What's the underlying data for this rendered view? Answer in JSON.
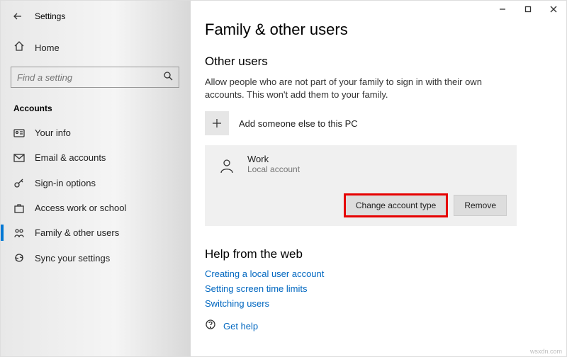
{
  "titlebar": {
    "minimize": "—",
    "maximize": "□",
    "close": "✕"
  },
  "header": {
    "app_title": "Settings"
  },
  "sidebar": {
    "home": "Home",
    "search_placeholder": "Find a setting",
    "section": "Accounts",
    "items": [
      "Your info",
      "Email & accounts",
      "Sign-in options",
      "Access work or school",
      "Family & other users",
      "Sync your settings"
    ]
  },
  "page": {
    "title": "Family & other users",
    "other_users": {
      "heading": "Other users",
      "description": "Allow people who are not part of your family to sign in with their own accounts. This won't add them to your family.",
      "add_label": "Add someone else to this PC",
      "user": {
        "name": "Work",
        "type": "Local account",
        "change_btn": "Change account type",
        "remove_btn": "Remove"
      }
    },
    "help": {
      "heading": "Help from the web",
      "links": [
        "Creating a local user account",
        "Setting screen time limits",
        "Switching users"
      ],
      "get_help": "Get help"
    }
  },
  "watermark": "wsxdn.com"
}
